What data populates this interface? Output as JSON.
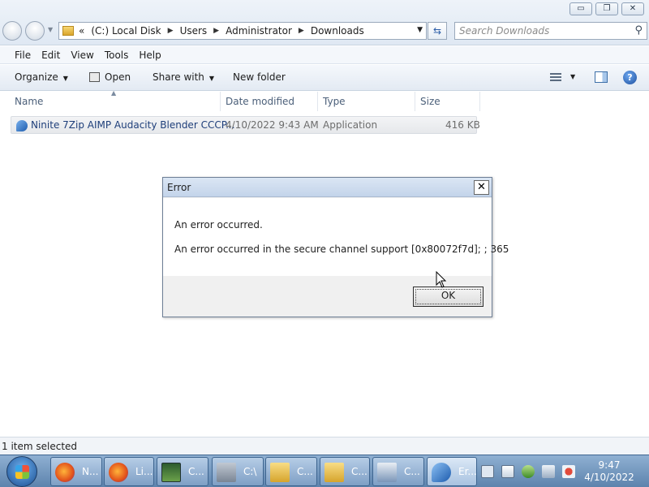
{
  "window": {
    "min_glyph": "▭",
    "max_glyph": "❐",
    "close_glyph": "✕"
  },
  "address": {
    "overflow": "«",
    "crumbs": [
      "(C:) Local Disk",
      "Users",
      "Administrator",
      "Downloads"
    ],
    "separator": "▶",
    "dropdown": "▼",
    "refresh_glyph": "⇆"
  },
  "search": {
    "placeholder": "Search Downloads",
    "icon": "search-icon",
    "glyph": "⚲"
  },
  "menubar": {
    "items": [
      "File",
      "Edit",
      "View",
      "Tools",
      "Help"
    ]
  },
  "toolbar": {
    "organize": "Organize",
    "open": "Open",
    "share_with": "Share with",
    "new_folder": "New folder",
    "caret": "▼",
    "help_glyph": "?"
  },
  "columns": {
    "name": "Name",
    "date_modified": "Date modified",
    "type": "Type",
    "size": "Size",
    "sort_arrow": "▲"
  },
  "files": [
    {
      "name": "Ninite 7Zip AIMP Audacity Blender CCCP...",
      "date_modified": "4/10/2022 9:43 AM",
      "type": "Application",
      "size": "416 KB"
    }
  ],
  "dialog": {
    "title": "Error",
    "close_glyph": "✕",
    "line1": "An error occurred.",
    "line2": "An error occurred in the secure channel support [0x80072f7d]; ; 365",
    "ok_label": "OK"
  },
  "status": {
    "text": "1 item selected"
  },
  "taskbar": {
    "buttons": [
      {
        "label": "N...",
        "icon": "firefox-icon"
      },
      {
        "label": "Li...",
        "icon": "firefox-icon"
      },
      {
        "label": "C...",
        "icon": "command-prompt-icon"
      },
      {
        "label": "C:\\",
        "icon": "network-drive-icon"
      },
      {
        "label": "C...",
        "icon": "folder-icon"
      },
      {
        "label": "C...",
        "icon": "folder-icon"
      },
      {
        "label": "C...",
        "icon": "remote-desktop-icon"
      },
      {
        "label": "Er...",
        "icon": "error-app-icon"
      }
    ],
    "clock_time": "9:47",
    "clock_date": "4/10/2022"
  }
}
